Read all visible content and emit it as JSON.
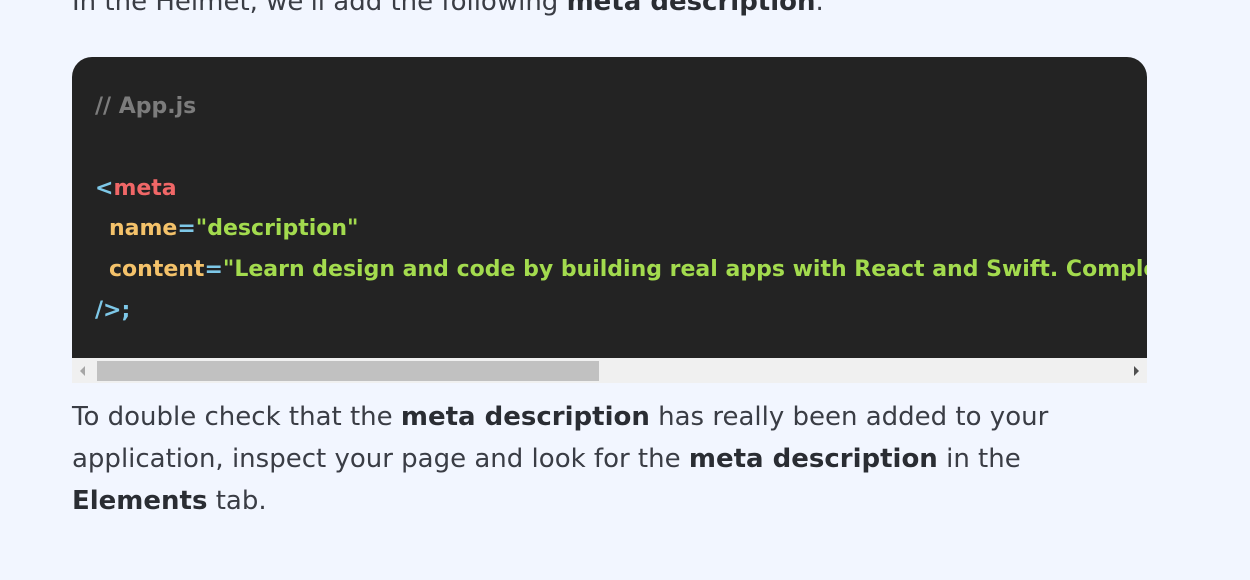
{
  "intro": {
    "text_before": "In the Helmet, we'll add the following ",
    "bold": "meta description",
    "text_after": "."
  },
  "code_block": {
    "comment": "// App.js",
    "line1": {
      "open": "<",
      "tag": "meta"
    },
    "line2": {
      "attr": "name",
      "eq": "=",
      "value": "\"description\""
    },
    "line3": {
      "attr": "content",
      "eq": "=",
      "value": "\"Learn design and code by building real apps with React and Swift. Complete co"
    },
    "line4": {
      "close": "/>;"
    },
    "colors": {
      "background": "#232323",
      "comment": "#7c7c7c",
      "punctuation": "#7ec8e8",
      "tag": "#f06767",
      "attribute": "#f4c26a",
      "string": "#a3db4e"
    },
    "scrollbar": {
      "position": 0.0
    }
  },
  "paragraph": {
    "t1": "To double check that the ",
    "b1": "meta description",
    "t2": " has really been added to your application, inspect your page and look for the ",
    "b2": "meta description",
    "t3": " in the ",
    "b3": "Elements",
    "t4": " tab."
  },
  "colors": {
    "page_background": "#f2f6ff",
    "text": "#3a3d45"
  }
}
